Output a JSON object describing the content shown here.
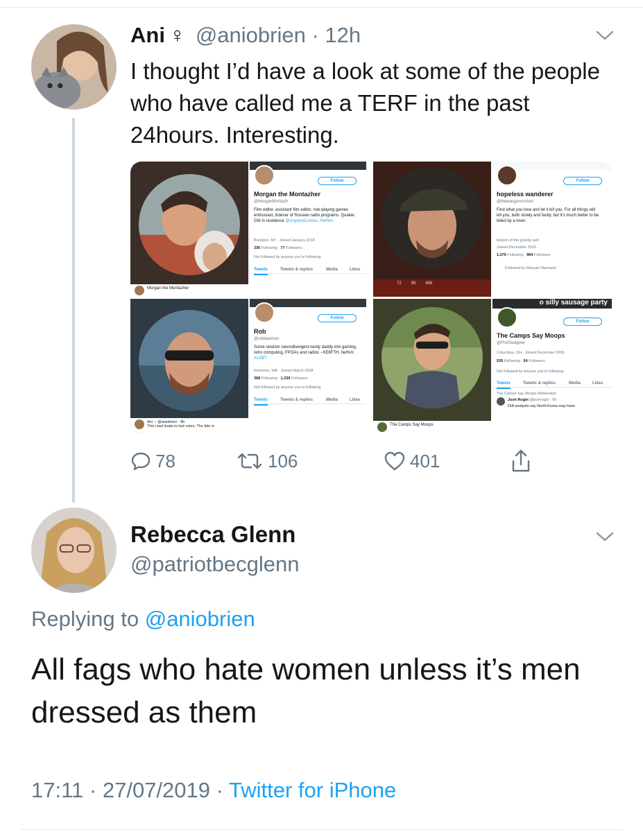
{
  "tweet1": {
    "name": "Ani",
    "name_symbol": "♀",
    "handle": "@aniobrien",
    "separator": "·",
    "time": "12h",
    "text": "I thought I’d have a look at some of the people who have called me a TERF in the past 24hours. Interesting.",
    "media": {
      "panels": [
        {
          "name": "Morgan the Montazher",
          "handle": "@MorganMontazh",
          "follow_label": "Follow",
          "bio": "Film editor, assistant film editor, role-playing games enthusiast, listener of Russian radio programs. Quaker. GM in residence",
          "bio_link": "@AnyoneComics. He/him.",
          "location": "Brooklyn, NY",
          "joined": "Joined January 2018",
          "following": "336",
          "following_label": "Following",
          "followers": "77",
          "followers_label": "Followers",
          "note": "Not followed by anyone you're following",
          "tabs": [
            "Tweets",
            "Tweets & replies",
            "Media",
            "Likes"
          ],
          "strip_text": "Morgan the Montazher"
        },
        {
          "name": "hopeless wanderer",
          "handle": "@thewargarurumon",
          "follow_label": "Follow",
          "bio": "Find what you love and let it kill you. For all things will kill you, both slowly and fastly, but it's much better to be killed by a lover.",
          "location": "bottom of the gravity well",
          "joined": "Joined December 2010",
          "following": "1,276",
          "following_label": "Following",
          "followers": "964",
          "followers_label": "Followers",
          "note": "Followed by Maryam Namazie",
          "stats_row": [
            "72",
            "89",
            "868"
          ]
        },
        {
          "name": "Rob",
          "handle": "@robdaemon",
          "follow_label": "Follow",
          "bio": "Some random neurodivergent nerdy daddy into gaming, retro computing, FPGAs and radios - KE6FTH. he/him",
          "bio_link": "#LGBT",
          "location": "Kenmore, WA",
          "joined": "Joined March 2008",
          "following": "368",
          "following_label": "Following",
          "followers": "1,339",
          "followers_label": "Followers",
          "note": "Not followed by anyone you're following",
          "tabs": [
            "Tweets",
            "Tweets & replies",
            "Media",
            "Likes"
          ],
          "strip_text": "Ani ♀ @aniobrien · 8h",
          "strip_text2": "This road leads to lost votes. The tide is"
        },
        {
          "banner_text": "o silly sausage party",
          "name": "The Camps Say Moops",
          "handle": "@ProfSwagner",
          "follow_label": "Follow",
          "location": "Columbus, OH",
          "joined": "Joined December 2009",
          "following": "535",
          "following_label": "Following",
          "followers": "54",
          "followers_label": "Followers",
          "note": "Not followed by anyone you're following",
          "tabs": [
            "Tweets",
            "Tweets & replies",
            "Media",
            "Likes"
          ],
          "retweet_line": "The Camps Say Moops Retweeted",
          "rt_author": "Josh Rogin",
          "rt_handle": "@joshrogin · 6h",
          "rt_text": "DIA analysts say North Korea may have",
          "strip_text": "The Camps Say Moops",
          "strip_handle": "@ProfSwagner"
        }
      ]
    },
    "actions": {
      "replies": "78",
      "retweets": "106",
      "likes": "401"
    }
  },
  "tweet2": {
    "name": "Rebecca Glenn",
    "handle": "@patriotbecglenn",
    "replying_prefix": "Replying to",
    "replying_to": "@aniobrien",
    "text": "All fags who hate women unless it’s men dressed as them",
    "time": "17:11",
    "date": "27/07/2019",
    "separator": "·",
    "source": "Twitter for iPhone"
  },
  "colors": {
    "link": "#1da1f2",
    "secondary_text": "#657786",
    "thread_line": "#ccd6dd"
  }
}
